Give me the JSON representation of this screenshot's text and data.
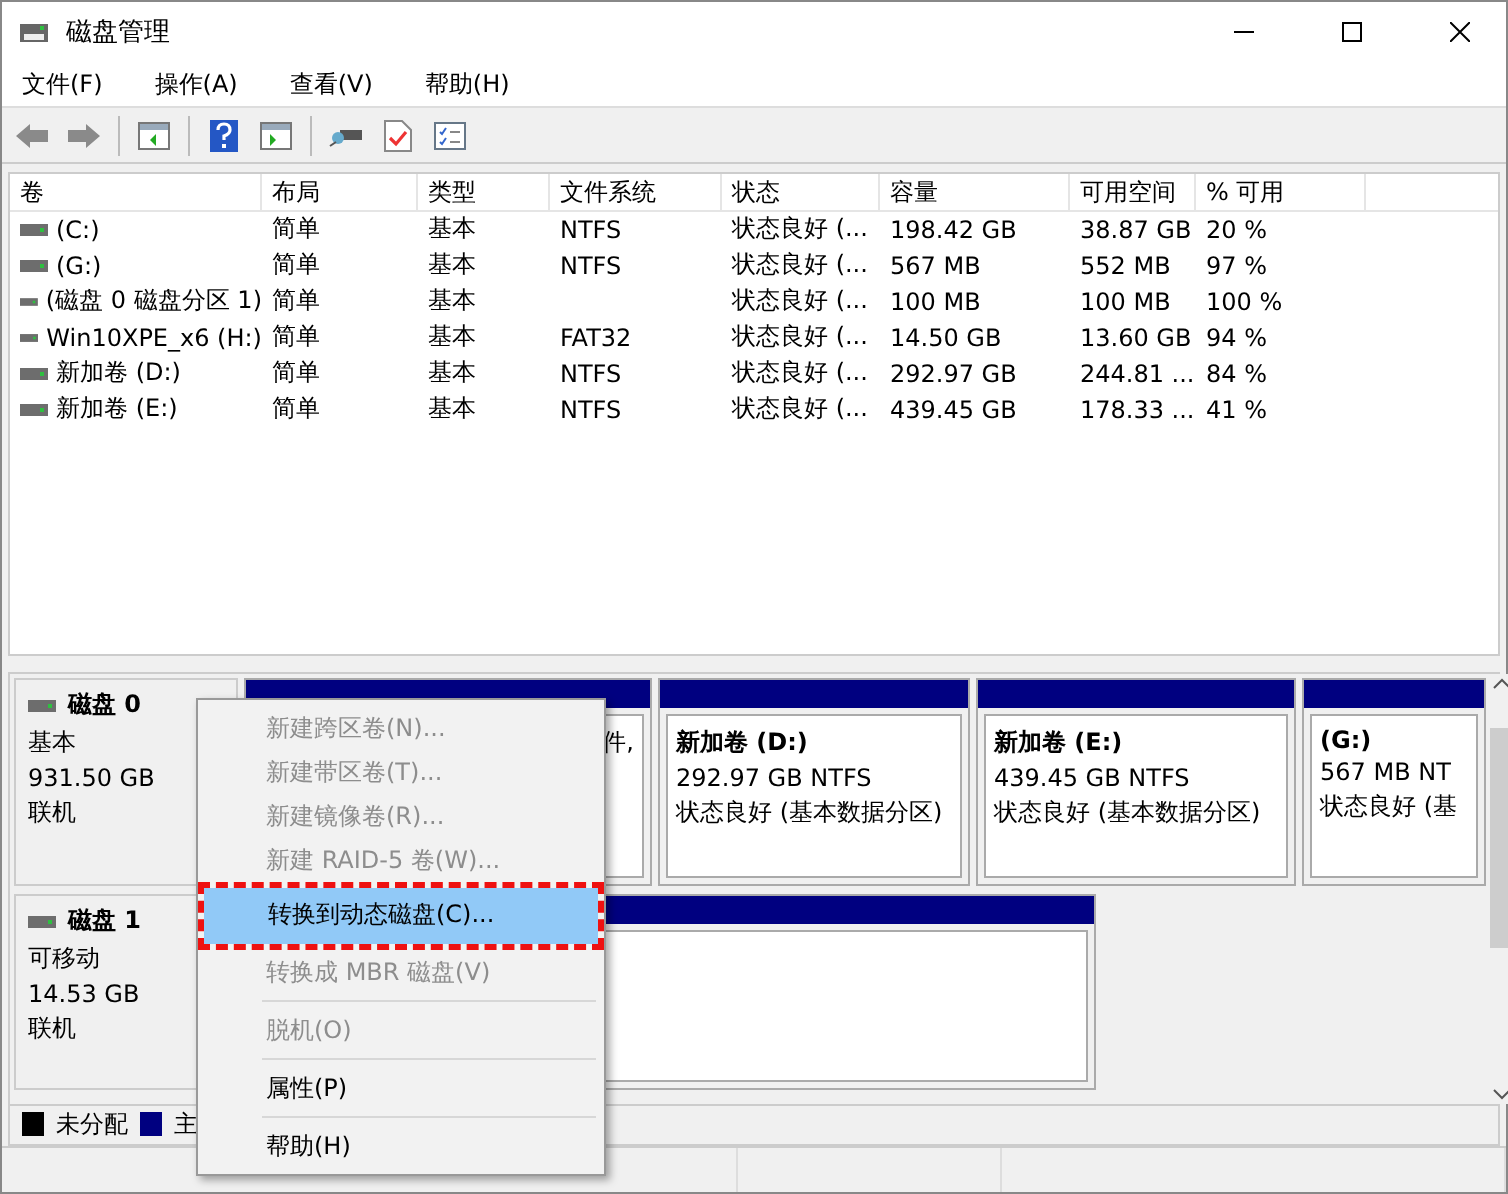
{
  "window": {
    "title": "磁盘管理"
  },
  "menu": [
    "文件(F)",
    "操作(A)",
    "查看(V)",
    "帮助(H)"
  ],
  "volumes": {
    "columns": [
      "卷",
      "布局",
      "类型",
      "文件系统",
      "状态",
      "容量",
      "可用空间",
      "% 可用"
    ],
    "rows": [
      {
        "cells": [
          "(C:)",
          "简单",
          "基本",
          "NTFS",
          "状态良好 (...",
          "198.42 GB",
          "38.87 GB",
          "20 %"
        ]
      },
      {
        "cells": [
          "(G:)",
          "简单",
          "基本",
          "NTFS",
          "状态良好 (...",
          "567 MB",
          "552 MB",
          "97 %"
        ]
      },
      {
        "cells": [
          "(磁盘 0 磁盘分区 1)",
          "简单",
          "基本",
          "",
          "状态良好 (...",
          "100 MB",
          "100 MB",
          "100 %"
        ]
      },
      {
        "cells": [
          "Win10XPE_x6 (H:)",
          "简单",
          "基本",
          "FAT32",
          "状态良好 (...",
          "14.50 GB",
          "13.60 GB",
          "94 %"
        ]
      },
      {
        "cells": [
          "新加卷 (D:)",
          "简单",
          "基本",
          "NTFS",
          "状态良好 (...",
          "292.97 GB",
          "244.81 ...",
          "84 %"
        ]
      },
      {
        "cells": [
          "新加卷 (E:)",
          "简单",
          "基本",
          "NTFS",
          "状态良好 (...",
          "439.45 GB",
          "178.33 ...",
          "41 %"
        ]
      }
    ]
  },
  "disks": [
    {
      "name": "磁盘 0",
      "type": "基本",
      "size": "931.50 GB",
      "status": "联机",
      "partitions": [
        {
          "kind": "primary",
          "lines": [
            "件,"
          ]
        },
        {
          "kind": "primary",
          "title": "新加卷 (D:)",
          "lines": [
            "292.97 GB NTFS",
            "状态良好 (基本数据分区)"
          ]
        },
        {
          "kind": "primary",
          "title": "新加卷 (E:)",
          "lines": [
            "439.45 GB NTFS",
            "状态良好 (基本数据分区)"
          ]
        },
        {
          "kind": "primary",
          "title": "(G:)",
          "lines": [
            "567 MB NT",
            "状态良好 (基"
          ]
        }
      ]
    },
    {
      "name": "磁盘 1",
      "type": "可移动",
      "size": "14.53 GB",
      "status": "联机",
      "partitions": [
        {
          "kind": "primary"
        }
      ]
    }
  ],
  "legend": [
    {
      "label": "未分配",
      "color": "#000000"
    },
    {
      "label": "主",
      "color": "#000080"
    }
  ],
  "context_menu": [
    {
      "label": "新建跨区卷(N)...",
      "disabled": true,
      "selected": false
    },
    {
      "label": "新建带区卷(T)...",
      "disabled": true,
      "selected": false
    },
    {
      "label": "新建镜像卷(R)...",
      "disabled": true,
      "selected": false
    },
    {
      "label": "新建 RAID-5 卷(W)...",
      "disabled": true,
      "selected": false
    },
    {
      "label": "转换到动态磁盘(C)...",
      "disabled": false,
      "selected": true
    },
    {
      "label": "转换成 MBR 磁盘(V)",
      "disabled": true,
      "selected": false,
      "separator_after": true
    },
    {
      "label": "脱机(O)",
      "disabled": true,
      "selected": false,
      "separator_after": true
    },
    {
      "label": "属性(P)",
      "disabled": false,
      "selected": false,
      "separator_after": true
    },
    {
      "label": "帮助(H)",
      "disabled": false,
      "selected": false
    }
  ]
}
